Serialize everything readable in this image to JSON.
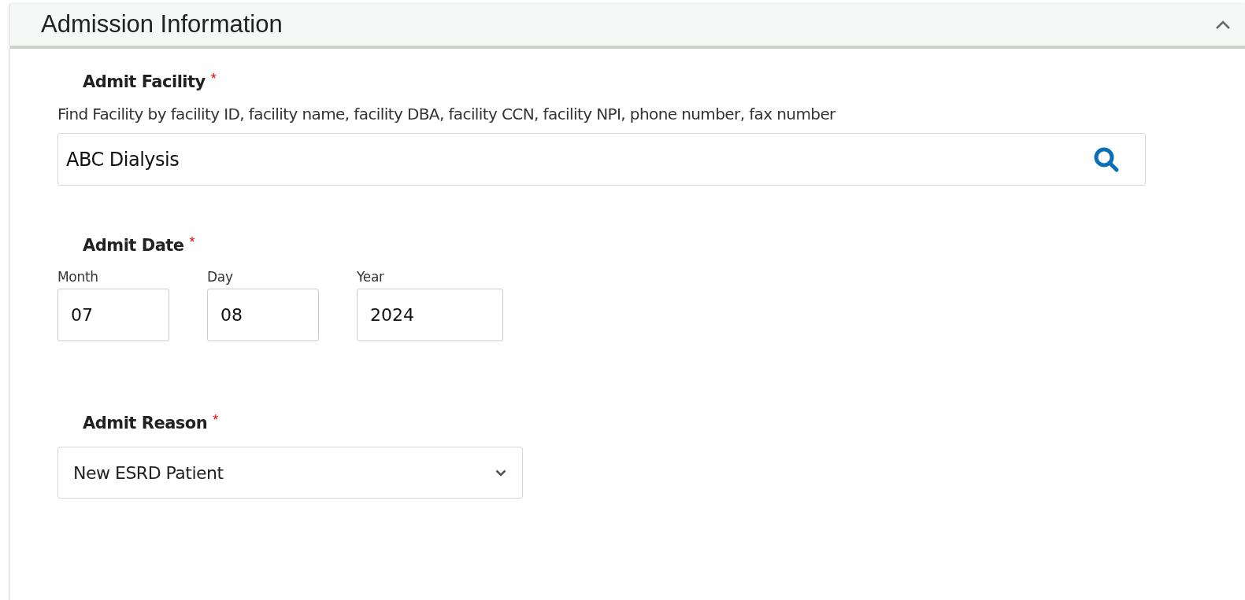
{
  "section": {
    "title": "Admission Information",
    "expanded": true
  },
  "facility": {
    "label": "Admit Facility",
    "required_mark": "*",
    "hint": "Find Facility by facility ID, facility name, facility DBA, facility CCN, facility NPI, phone number, fax number",
    "value": "ABC Dialysis"
  },
  "admit_date": {
    "label": "Admit Date",
    "required_mark": "*",
    "parts": [
      {
        "label": "Month",
        "value": "07"
      },
      {
        "label": "Day",
        "value": "08"
      },
      {
        "label": "Year",
        "value": "2024"
      }
    ]
  },
  "admit_reason": {
    "label": "Admit Reason",
    "required_mark": "*",
    "value": "New ESRD Patient"
  }
}
